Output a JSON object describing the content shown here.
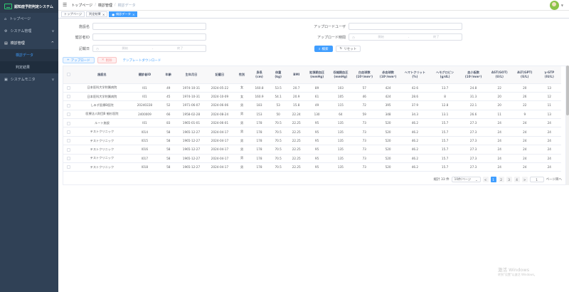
{
  "app": {
    "title": "認知症予防判定システム"
  },
  "sidebar": {
    "items": [
      {
        "label": "トップページ",
        "icon": "home-icon"
      },
      {
        "label": "システム管理",
        "icon": "settings-icon",
        "arrow": "v"
      },
      {
        "label": "検診管理",
        "icon": "clipboard-icon",
        "arrow": "^"
      },
      {
        "label": "システムモニタ",
        "icon": "monitor-icon",
        "arrow": "v"
      }
    ],
    "sub": [
      {
        "label": "検診データ"
      },
      {
        "label": "判定結果"
      }
    ]
  },
  "breadcrumb": {
    "items": [
      "トップページ",
      "検診管理",
      "検診データ"
    ],
    "sep": "/"
  },
  "tags": [
    {
      "label": "トップページ"
    },
    {
      "label": "判定結果"
    },
    {
      "label": "検診データ"
    }
  ],
  "form": {
    "facility_label": "施設名",
    "checkup_id_label": "健診者ID",
    "record_date_label": "記載日",
    "upload_user_label": "アップロードユーザ",
    "upload_time_label": "アップロード時間",
    "start_placeholder": "開始",
    "end_placeholder": "終了",
    "range_sep": "-",
    "search_btn": "検索",
    "reset_btn": "リセット"
  },
  "toolbar": {
    "upload_btn": "アップロード",
    "delete_btn": "削除",
    "template_btn": "テンプレートダウンロード"
  },
  "table": {
    "headers": [
      "施設名",
      "健診者ID",
      "年齢",
      "生年月日",
      "記載日",
      "性別",
      "身長\n(cm)",
      "体重\n(kg)",
      "BMI",
      "拡張期血圧\n(mmHg)",
      "収縮期血圧\n(mmHg)",
      "白血球数\n(10³/mm³)",
      "赤血球数\n(10⁶/mm³)",
      "ヘマトクリット\n(%)",
      "ヘモグロビン\n(g/dL)",
      "血小板数\n(10⁴/mm³)",
      "AST(GOT)\n(U/L)",
      "ALT(GPT)\n(U/L)",
      "γ-GTP\n(IU/L)"
    ],
    "rows": [
      [
        "日本医科大学附属病院",
        "l01",
        "49",
        "1974-10-31",
        "2024-05-22",
        "女",
        "160.8",
        "53.5",
        "20.7",
        "89",
        "103",
        "57",
        "424",
        "42.6",
        "13.7",
        "24.8",
        "22",
        "20",
        "13"
      ],
      [
        "日本医科大学附属病院",
        "l01",
        "45",
        "1974-10-31",
        "2024-10-09",
        "女",
        "160.9",
        "54.1",
        "20.9",
        "61",
        "105",
        "46",
        "424",
        "28.6",
        "8",
        "31.3",
        "20",
        "26",
        "12"
      ],
      [
        "しみず医療B医院",
        "20240228",
        "52",
        "1971-06-07",
        "2024-06-06",
        "男",
        "183",
        "53",
        "15.8",
        "49",
        "115",
        "72",
        "395",
        "37.9",
        "12.8",
        "22.1",
        "20",
        "22",
        "11"
      ],
      [
        "医療法人財団B 細杉医院",
        "2400009",
        "66",
        "1958-02-28",
        "2024-08-24",
        "男",
        "153",
        "50",
        "22.24",
        "130",
        "64",
        "59",
        "348",
        "34.3",
        "13.1",
        "26.6",
        "11",
        "9",
        "13"
      ],
      [
        "ルート施設",
        "l01",
        "83",
        "1965-01-01",
        "2024-06-01",
        "男",
        "178",
        "70.5",
        "22.25",
        "95",
        "135",
        "73",
        "520",
        "46.2",
        "15.7",
        "27.3",
        "24",
        "24",
        "24"
      ],
      [
        "テストクリニック",
        "l014",
        "58",
        "1965-12-27",
        "2024-04-17",
        "男",
        "178",
        "70.5",
        "22.25",
        "95",
        "135",
        "73",
        "520",
        "46.2",
        "15.7",
        "27.3",
        "24",
        "24",
        "24"
      ],
      [
        "テストクリニック",
        "l015",
        "58",
        "1965-12-27",
        "2024-04-17",
        "男",
        "178",
        "70.5",
        "22.25",
        "95",
        "135",
        "73",
        "520",
        "46.2",
        "15.7",
        "27.3",
        "24",
        "24",
        "24"
      ],
      [
        "テストクリニック",
        "l016",
        "58",
        "1965-12-27",
        "2024-04-17",
        "男",
        "178",
        "70.5",
        "22.25",
        "95",
        "135",
        "73",
        "520",
        "46.2",
        "15.7",
        "27.3",
        "24",
        "24",
        "24"
      ],
      [
        "テストクリニック",
        "l017",
        "58",
        "1965-12-27",
        "2024-04-17",
        "男",
        "178",
        "70.5",
        "22.25",
        "95",
        "135",
        "73",
        "520",
        "46.2",
        "15.7",
        "27.3",
        "24",
        "24",
        "24"
      ],
      [
        "テストクリニック",
        "l018",
        "58",
        "1965-12-27",
        "2024-04-17",
        "男",
        "178",
        "70.5",
        "22.25",
        "95",
        "135",
        "73",
        "520",
        "46.2",
        "15.7",
        "27.3",
        "24",
        "24",
        "24"
      ]
    ]
  },
  "pager": {
    "total": "総計 33 件",
    "size": "10件/ページ",
    "prev": "<",
    "pages": [
      "1",
      "2",
      "3",
      "4"
    ],
    "next": ">",
    "goto_value": "1",
    "goto_suffix": "ページ目へ"
  },
  "watermark": {
    "line1": "激活 Windows",
    "line2": "转到\"设置\"以激活 Windows。"
  },
  "colors": {
    "sidebar": "#304156",
    "primary": "#409eff",
    "logo_green": "#2ecc71"
  }
}
